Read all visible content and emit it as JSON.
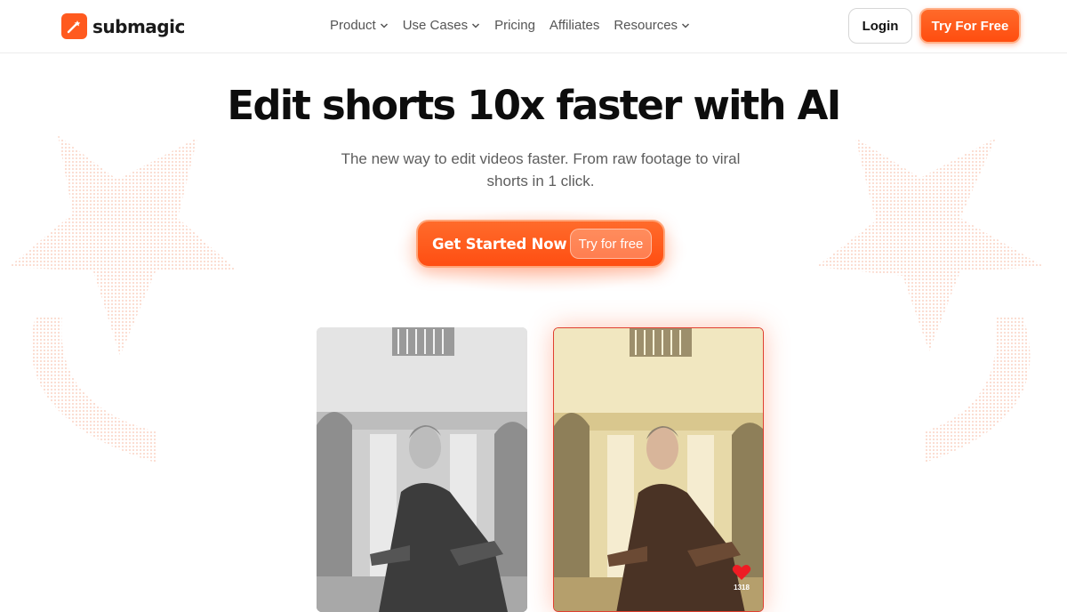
{
  "brand": {
    "name": "submagic",
    "color": "#ff5a1f"
  },
  "nav": {
    "items": [
      {
        "label": "Product",
        "has_dropdown": true
      },
      {
        "label": "Use Cases",
        "has_dropdown": true
      },
      {
        "label": "Pricing",
        "has_dropdown": false
      },
      {
        "label": "Affiliates",
        "has_dropdown": false
      },
      {
        "label": "Resources",
        "has_dropdown": true
      }
    ],
    "login_label": "Login",
    "try_label": "Try For Free"
  },
  "hero": {
    "title": "Edit shorts 10x faster with AI",
    "subtitle": "The new way to edit videos faster. From raw footage to viral shorts in 1 click.",
    "cta_label": "Get Started Now",
    "cta_pill": "Try for free"
  },
  "videos": {
    "before": {
      "style": "grayscale"
    },
    "after": {
      "style": "color",
      "like_icon": "heart-icon",
      "like_count": "1318"
    }
  },
  "icons": {
    "chevron": "chevron-down-icon",
    "logo": "magic-wand-icon"
  }
}
